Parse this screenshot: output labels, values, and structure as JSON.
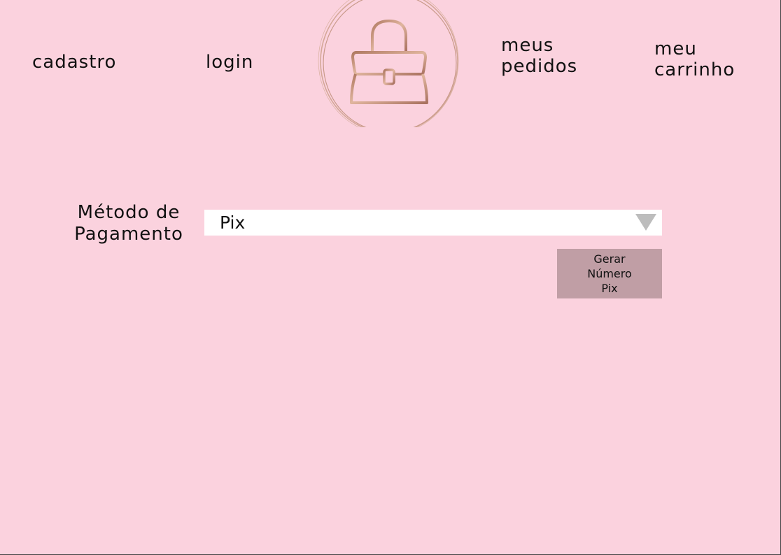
{
  "nav": {
    "cadastro": "cadastro",
    "login": "login",
    "pedidos": "meus\npedidos",
    "carrinho": "meu\ncarrinho"
  },
  "logo": {
    "icon": "handbag-icon",
    "color": "#c58f78"
  },
  "payment": {
    "label": "Método de\nPagamento",
    "selected": "Pix"
  },
  "actions": {
    "generate_pix_label": "Gerar\nNúmero\nPix"
  },
  "colors": {
    "background": "#fbd2de",
    "button": "#c09ea5",
    "arrow": "#bdbdbd"
  }
}
